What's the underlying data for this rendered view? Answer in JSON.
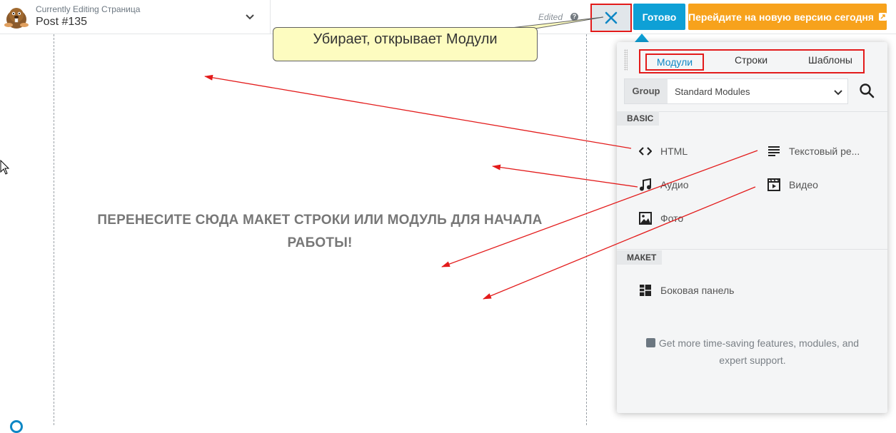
{
  "topbar": {
    "caption": "Currently Editing Страница",
    "title": "Post #135",
    "edited": "Edited",
    "help": "?",
    "done_label": "Готово",
    "upgrade_label": "Перейдите на новую версию сегодня",
    "done_color": "#0ea0d6",
    "upgrade_color": "#f7a21c"
  },
  "canvas": {
    "drop_text": "ПЕРЕНЕСИТЕ СЮДА МАКЕТ СТРОКИ ИЛИ МОДУЛЬ ДЛЯ НАЧАЛА РАБОТЫ!"
  },
  "tooltip": {
    "text": "Убирает, открывает Модули"
  },
  "panel": {
    "tabs": [
      {
        "label": "Модули",
        "active": true
      },
      {
        "label": "Строки",
        "active": false
      },
      {
        "label": "Шаблоны",
        "active": false
      }
    ],
    "group": {
      "label": "Group",
      "value": "Standard Modules"
    },
    "sections": [
      {
        "title": "BASIC",
        "modules": [
          {
            "label": "HTML",
            "icon": "code-icon"
          },
          {
            "label": "Текстовый ре...",
            "icon": "text-lines-icon"
          },
          {
            "label": "Аудио",
            "icon": "music-note-icon"
          },
          {
            "label": "Видео",
            "icon": "video-icon"
          },
          {
            "label": "Фото",
            "icon": "photo-icon"
          }
        ]
      },
      {
        "title": "МАКЕТ",
        "modules": [
          {
            "label": "Боковая панель",
            "icon": "sidebar-layout-icon"
          }
        ]
      }
    ],
    "promo": "Get more time-saving features, modules, and expert support."
  },
  "colors": {
    "annotation_red": "#e31b1b",
    "tooltip_bg": "#fdfcc0",
    "active_tab": "#0e87c5"
  }
}
